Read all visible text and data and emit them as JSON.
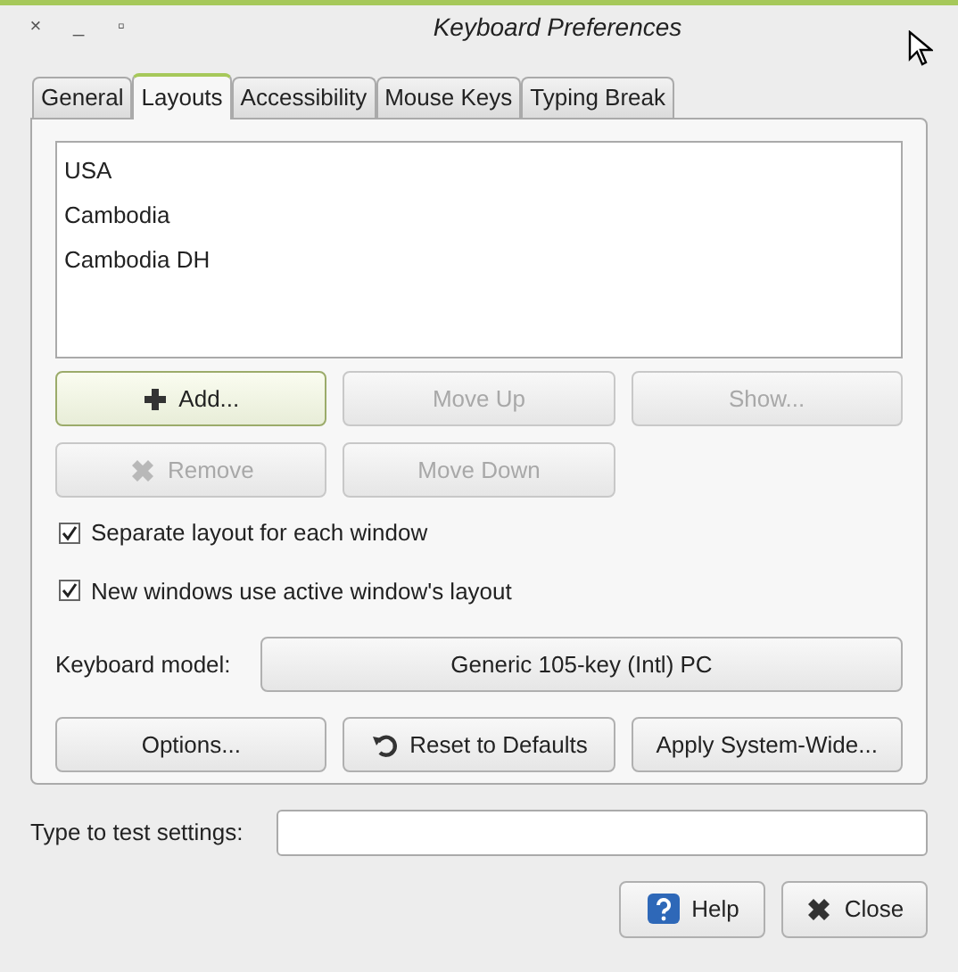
{
  "window": {
    "title": "Keyboard Preferences",
    "controls": [
      "×",
      "_",
      "▫"
    ]
  },
  "tabs": [
    {
      "label": "General",
      "selected": false
    },
    {
      "label": "Layouts",
      "selected": true
    },
    {
      "label": "Accessibility",
      "selected": false
    },
    {
      "label": "Mouse Keys",
      "selected": false
    },
    {
      "label": "Typing Break",
      "selected": false
    }
  ],
  "layouts": [
    "USA",
    "Cambodia",
    "Cambodia DH"
  ],
  "layout_buttons": [
    {
      "label": "Add...",
      "kind": "plus",
      "disabled": false,
      "focused": true
    },
    {
      "label": "Move Up",
      "disabled": true,
      "focused": false
    },
    {
      "label": "Show...",
      "disabled": true,
      "focused": false
    },
    {
      "label": "Remove",
      "kind": "x",
      "disabled": true,
      "focused": false
    },
    {
      "label": "Move Down",
      "disabled": true,
      "focused": false
    }
  ],
  "checkboxes": [
    {
      "label": "Separate layout for each window",
      "checked": true
    },
    {
      "label": "New windows use active window's layout",
      "checked": true
    }
  ],
  "keyboard_model": {
    "label": "Keyboard model:",
    "value": "Generic 105-key (Intl) PC"
  },
  "action_buttons": [
    {
      "label": "Options..."
    },
    {
      "label": "Reset to Defaults",
      "kind": "reset"
    },
    {
      "label": "Apply System-Wide..."
    }
  ],
  "test_field": {
    "label": "Type to test settings:"
  },
  "dialog_buttons": [
    {
      "label": "Help",
      "kind": "help"
    },
    {
      "label": "Close",
      "kind": "x"
    }
  ]
}
